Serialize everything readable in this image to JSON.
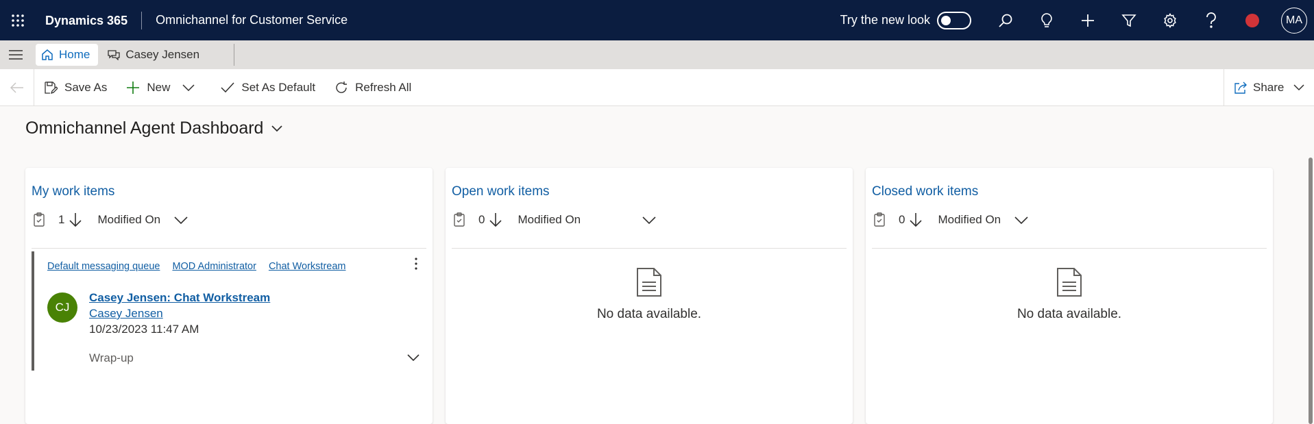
{
  "topbar": {
    "brand": "Dynamics 365",
    "app_name": "Omnichannel for Customer Service",
    "try_new_look": "Try the new look",
    "toggle_on": false,
    "icons": [
      "search-icon",
      "lightbulb-icon",
      "plus-icon",
      "filter-icon",
      "settings-icon",
      "help-icon"
    ],
    "presence_color": "#d13438",
    "user_initials": "MA"
  },
  "tabs": [
    {
      "label": "Home",
      "active": true,
      "icon": "home-icon"
    },
    {
      "label": "Casey Jensen",
      "active": false,
      "icon": "chat-icon"
    }
  ],
  "commandbar": {
    "save_as": "Save As",
    "new": "New",
    "set_as_default": "Set As Default",
    "refresh_all": "Refresh All",
    "share": "Share"
  },
  "dashboard": {
    "title": "Omnichannel Agent Dashboard"
  },
  "panels": [
    {
      "title": "My work items",
      "count": "1",
      "sort_field": "Modified On",
      "items": [
        {
          "queue": "Default messaging queue",
          "owner": "MOD Administrator",
          "workstream": "Chat Workstream",
          "initials": "CJ",
          "avatar_color": "#498205",
          "title": "Casey Jensen: Chat Workstream",
          "customer": "Casey Jensen",
          "modified": "10/23/2023 11:47 AM",
          "status": "Wrap-up"
        }
      ]
    },
    {
      "title": "Open work items",
      "count": "0",
      "sort_field": "Modified On",
      "empty_text": "No data available."
    },
    {
      "title": "Closed work items",
      "count": "0",
      "sort_field": "Modified On",
      "empty_text": "No data available."
    }
  ]
}
